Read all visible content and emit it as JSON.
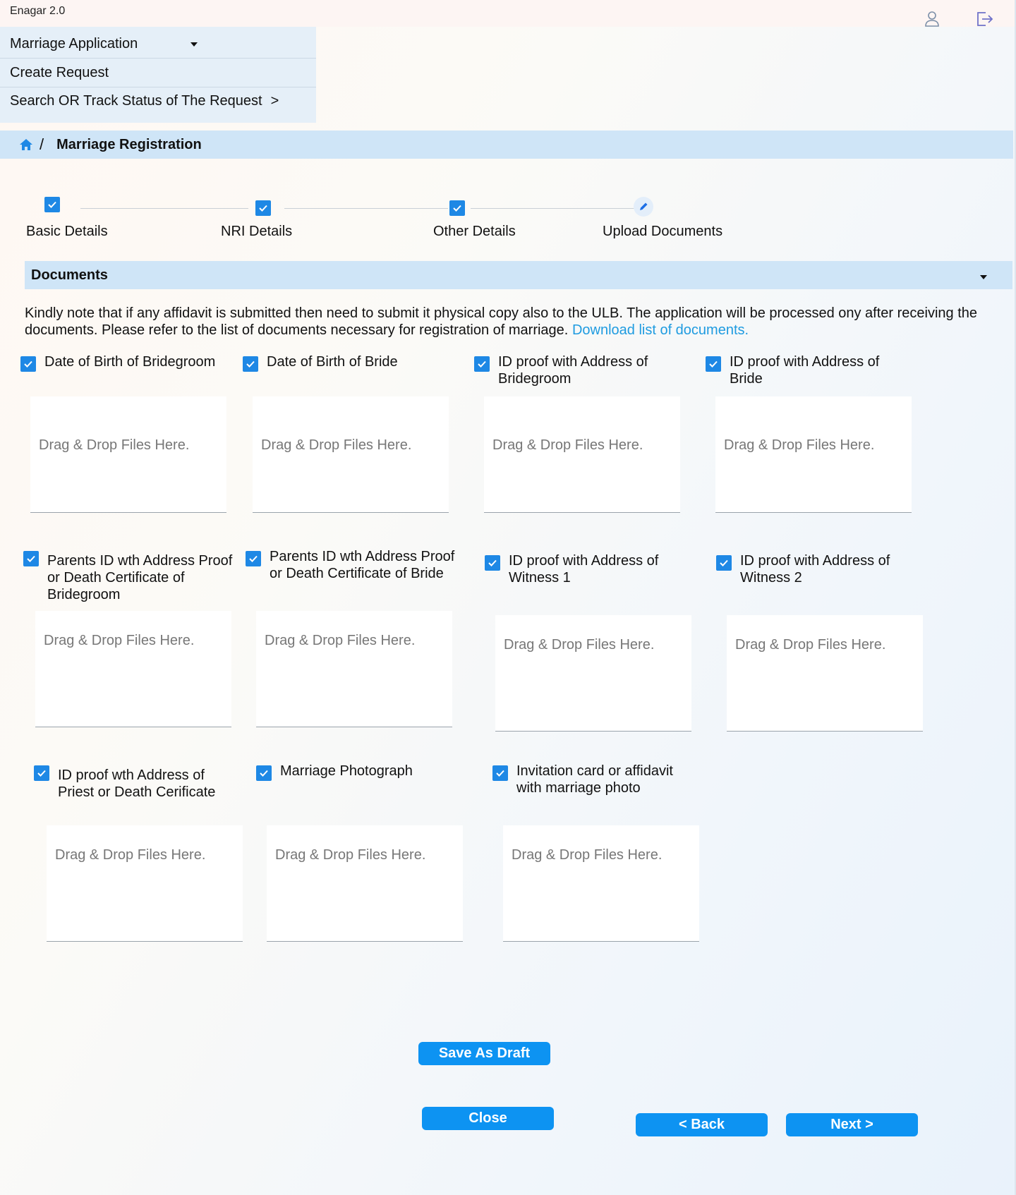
{
  "app": {
    "title": "Enagar 2.0"
  },
  "header_icons": {
    "user": "user-icon",
    "logout": "logout-icon"
  },
  "menu": {
    "items": [
      {
        "label": "Marriage Application"
      },
      {
        "label": "Create Request"
      },
      {
        "label": "Search OR Track Status of The Request",
        "suffix": ">"
      }
    ]
  },
  "breadcrumb": {
    "home_icon": "home-icon",
    "separator": "/",
    "title": "Marriage Registration"
  },
  "steps": [
    {
      "label": "Basic Details",
      "status": "done"
    },
    {
      "label": "NRI Details",
      "status": "done"
    },
    {
      "label": "Other Details",
      "status": "done"
    },
    {
      "label": "Upload Documents",
      "status": "current"
    }
  ],
  "documents": {
    "title": "Documents",
    "note": "Kindly note that if any affidavit is submitted  then need to submit it physical copy also to the ULB. The application will be processed ony after receiving the documents. Please refer to the list of documents necessary for registration of marriage.",
    "download_link": "Download list of documents.",
    "dropzone_text": "Drag & Drop Files Here.",
    "items": [
      {
        "label": "Date of Birth of Bridegroom",
        "checked": true
      },
      {
        "label": "Date of Birth of Bride",
        "checked": true
      },
      {
        "label": "ID proof with Address of Bridegroom",
        "checked": true
      },
      {
        "label": "ID proof with Address of Bride",
        "checked": true
      },
      {
        "label": "Parents ID wth Address Proof or Death Certificate of Bridegroom",
        "checked": true
      },
      {
        "label": "Parents ID wth Address Proof or Death Certificate of Bride",
        "checked": true
      },
      {
        "label": "ID proof with  Address of Witness 1",
        "checked": true
      },
      {
        "label": "ID proof with  Address of Witness 2",
        "checked": true
      },
      {
        "label": "ID proof wth Address of Priest or Death Cerificate",
        "checked": true
      },
      {
        "label": "Marriage Photograph",
        "checked": true
      },
      {
        "label": "Invitation card or affidavit with marriage photo",
        "checked": true
      }
    ]
  },
  "buttons": {
    "save_draft": "Save As Draft",
    "close": "Close",
    "back": "< Back",
    "next": "Next >"
  },
  "colors": {
    "accent": "#1e88e5",
    "button": "#0d93f2",
    "link": "#1e9be0",
    "band": "#cfe5f7"
  }
}
